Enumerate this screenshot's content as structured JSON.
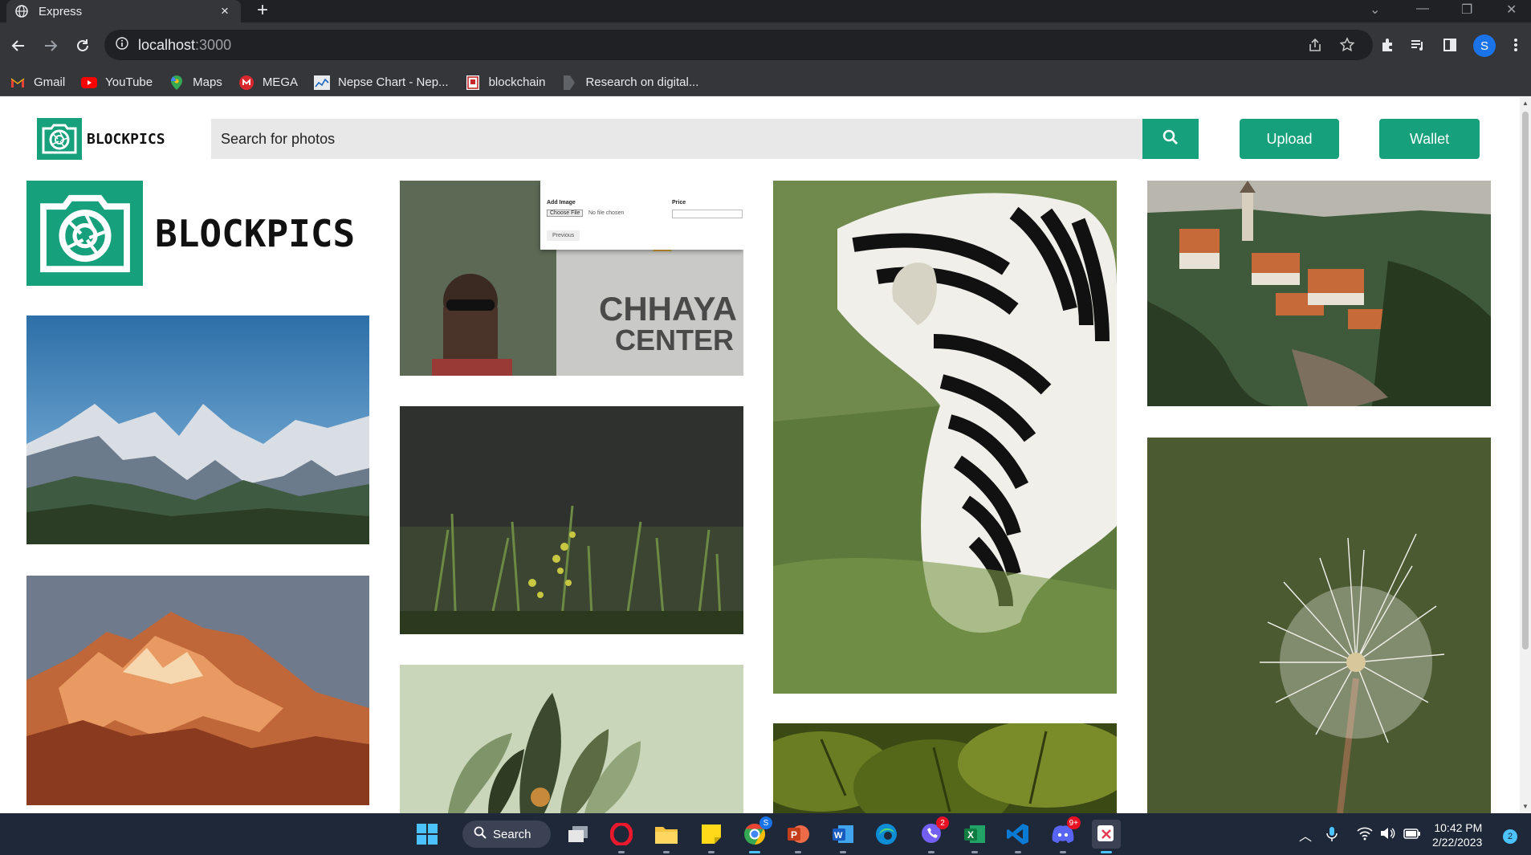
{
  "browser": {
    "tab_title": "Express",
    "new_tab": "+",
    "tab_close": "×",
    "url_host": "localhost",
    "url_port": ":3000",
    "profile_initial": "S",
    "bookmarks": [
      {
        "label": "Gmail",
        "icon": "gmail-icon"
      },
      {
        "label": "YouTube",
        "icon": "youtube-icon"
      },
      {
        "label": "Maps",
        "icon": "maps-icon"
      },
      {
        "label": "MEGA",
        "icon": "mega-icon"
      },
      {
        "label": "Nepse Chart - Nep...",
        "icon": "nepse-icon"
      },
      {
        "label": "blockchain",
        "icon": "blockchain-icon"
      },
      {
        "label": "Research on digital...",
        "icon": "research-icon"
      }
    ]
  },
  "site": {
    "brand": "BLOCKPICS",
    "search_placeholder": "Search for photos",
    "upload_label": "Upload",
    "wallet_label": "Wallet",
    "accent": "#17a07c"
  },
  "screenshot_card": {
    "add_image_label": "Add Image",
    "choose_file": "Choose File",
    "no_file": "No file chosen",
    "price_label": "Price",
    "previous": "Previous",
    "sign_line1": "CHHAYA",
    "sign_line2": "CENTER"
  },
  "photos": [
    {
      "name": "mountains-blue-sky"
    },
    {
      "name": "golden-mountain-peak"
    },
    {
      "name": "upload-screenshot"
    },
    {
      "name": "grass-flowers"
    },
    {
      "name": "leaf-illustration"
    },
    {
      "name": "zebra"
    },
    {
      "name": "green-leaves"
    },
    {
      "name": "cesky-krumlov-town"
    },
    {
      "name": "dandelion"
    }
  ],
  "taskbar": {
    "search_label": "Search",
    "time": "10:42 PM",
    "date": "2/22/2023",
    "notification_count": "2",
    "chrome_badge": "S",
    "viber_badge": "2",
    "discord_badge": "9+"
  }
}
